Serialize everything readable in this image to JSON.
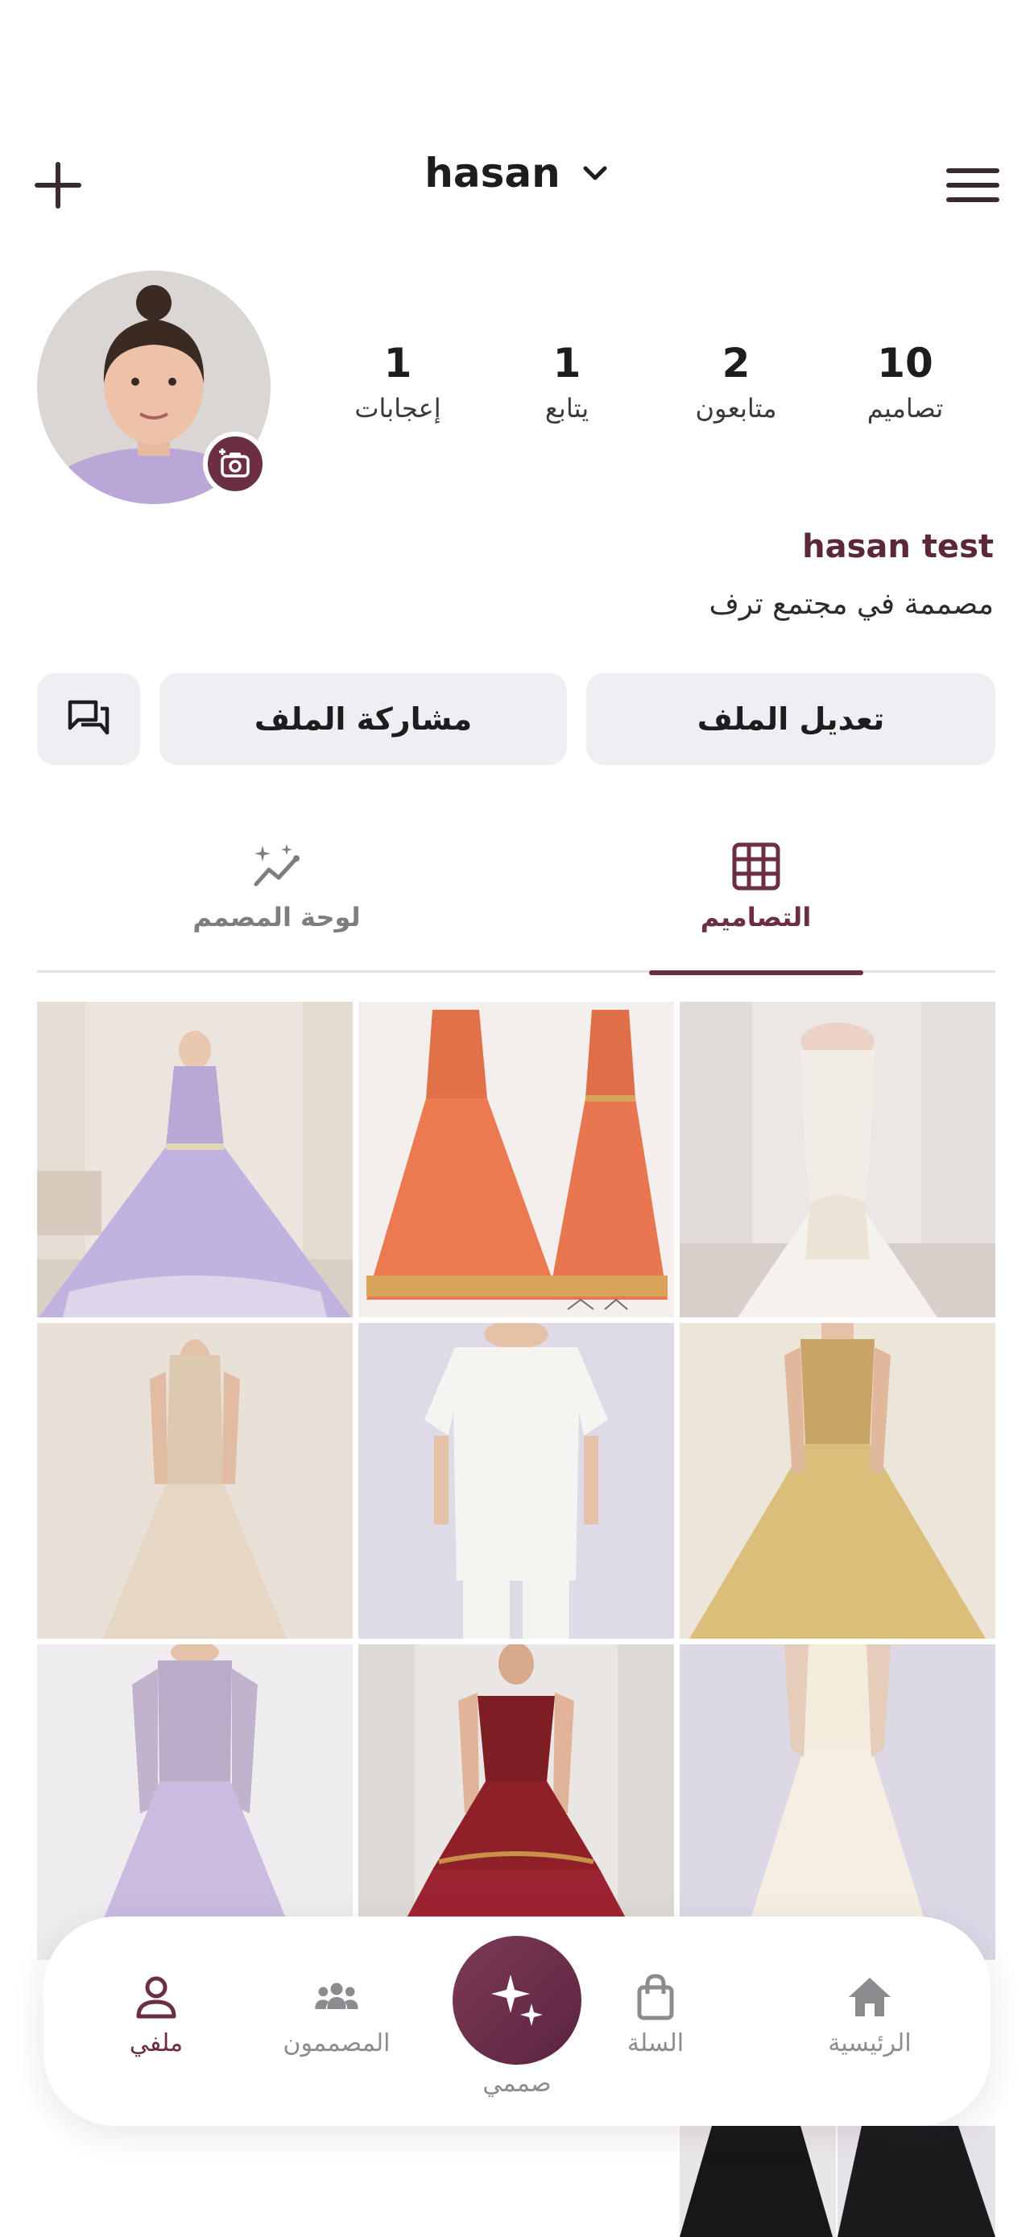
{
  "header": {
    "username": "hasan",
    "add_icon": "plus-icon",
    "menu_icon": "hamburger-menu-icon",
    "switcher_icon": "chevron-down-icon"
  },
  "profile": {
    "avatar_icon": "profile-photo",
    "camera_icon": "camera-add-icon",
    "stats": [
      {
        "value": "10",
        "label": "تصاميم"
      },
      {
        "value": "2",
        "label": "متابعون"
      },
      {
        "value": "1",
        "label": "يتابع"
      },
      {
        "value": "1",
        "label": "إعجابات"
      }
    ],
    "display_name": "hasan test",
    "bio": "مصممة في مجتمع ترف"
  },
  "actions": {
    "edit_label": "تعديل الملف",
    "share_label": "مشاركة الملف",
    "message_icon": "chat-bubbles-icon"
  },
  "tabs": [
    {
      "label": "التصاميم",
      "icon": "grid-icon",
      "active": true
    },
    {
      "label": "لوحة المصمم",
      "icon": "sparkle-chart-icon",
      "active": false
    }
  ],
  "designs": [
    {
      "name": "lavender-ballgown"
    },
    {
      "name": "orange-gown-sketch"
    },
    {
      "name": "ivory-mermaid-gown"
    },
    {
      "name": "beige-lace-gown"
    },
    {
      "name": "white-tunic-set"
    },
    {
      "name": "gold-tulle-gown"
    },
    {
      "name": "lilac-lace-gown"
    },
    {
      "name": "burgundy-layered-gown"
    },
    {
      "name": "cream-ballgown"
    }
  ],
  "nav": {
    "home": "الرئيسية",
    "cart": "السلة",
    "design": "صممي",
    "designers": "المصممون",
    "profile": "ملفي"
  },
  "colors": {
    "accent": "#6b2e45",
    "button_bg": "#efeff3"
  }
}
